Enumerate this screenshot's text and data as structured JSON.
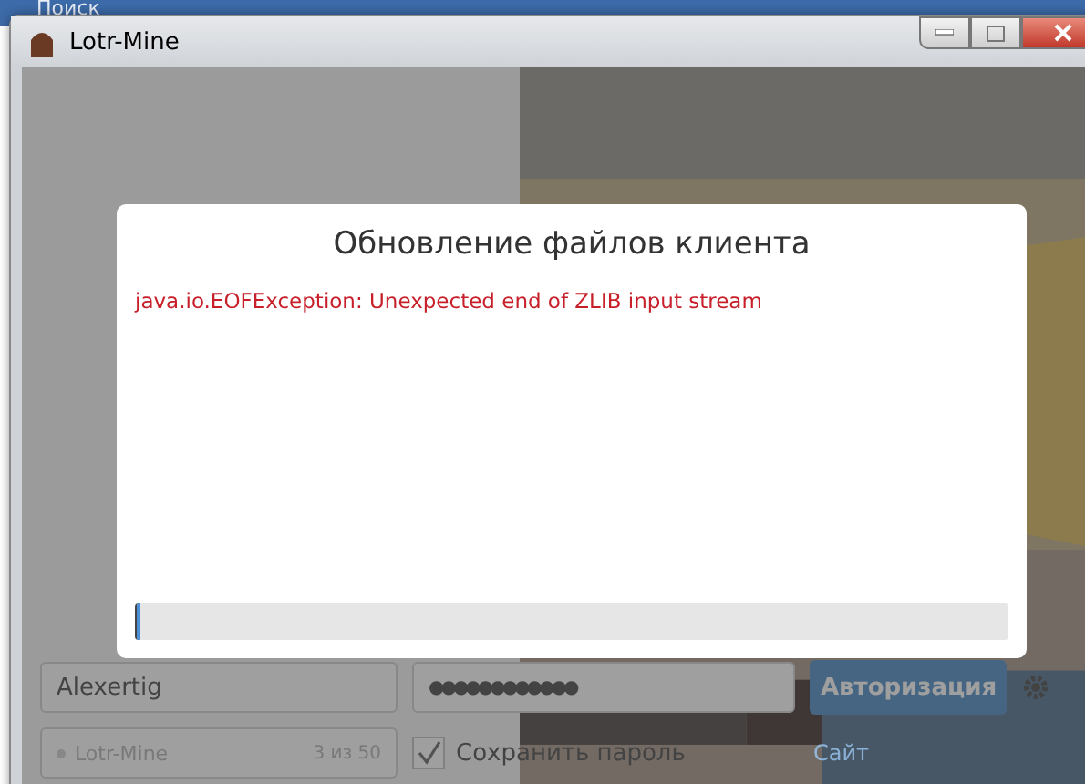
{
  "desktop": {
    "search_label": "Поиск"
  },
  "window": {
    "title": "Lotr-Mine"
  },
  "dialog": {
    "title": "Обновление файлов клиента",
    "error": "java.io.EOFException: Unexpected end of ZLIB input stream",
    "progress": {
      "level": 0.005
    }
  },
  "login": {
    "username": "Alexertig",
    "password": "●●●●●●●●●●●●",
    "server": {
      "name": "Lotr-Mine",
      "online": "3 из 50"
    },
    "save_password": {
      "label": "Сохранить пароль",
      "checked": true
    },
    "login_button": "Авторизация",
    "site_link": "Сайт"
  }
}
